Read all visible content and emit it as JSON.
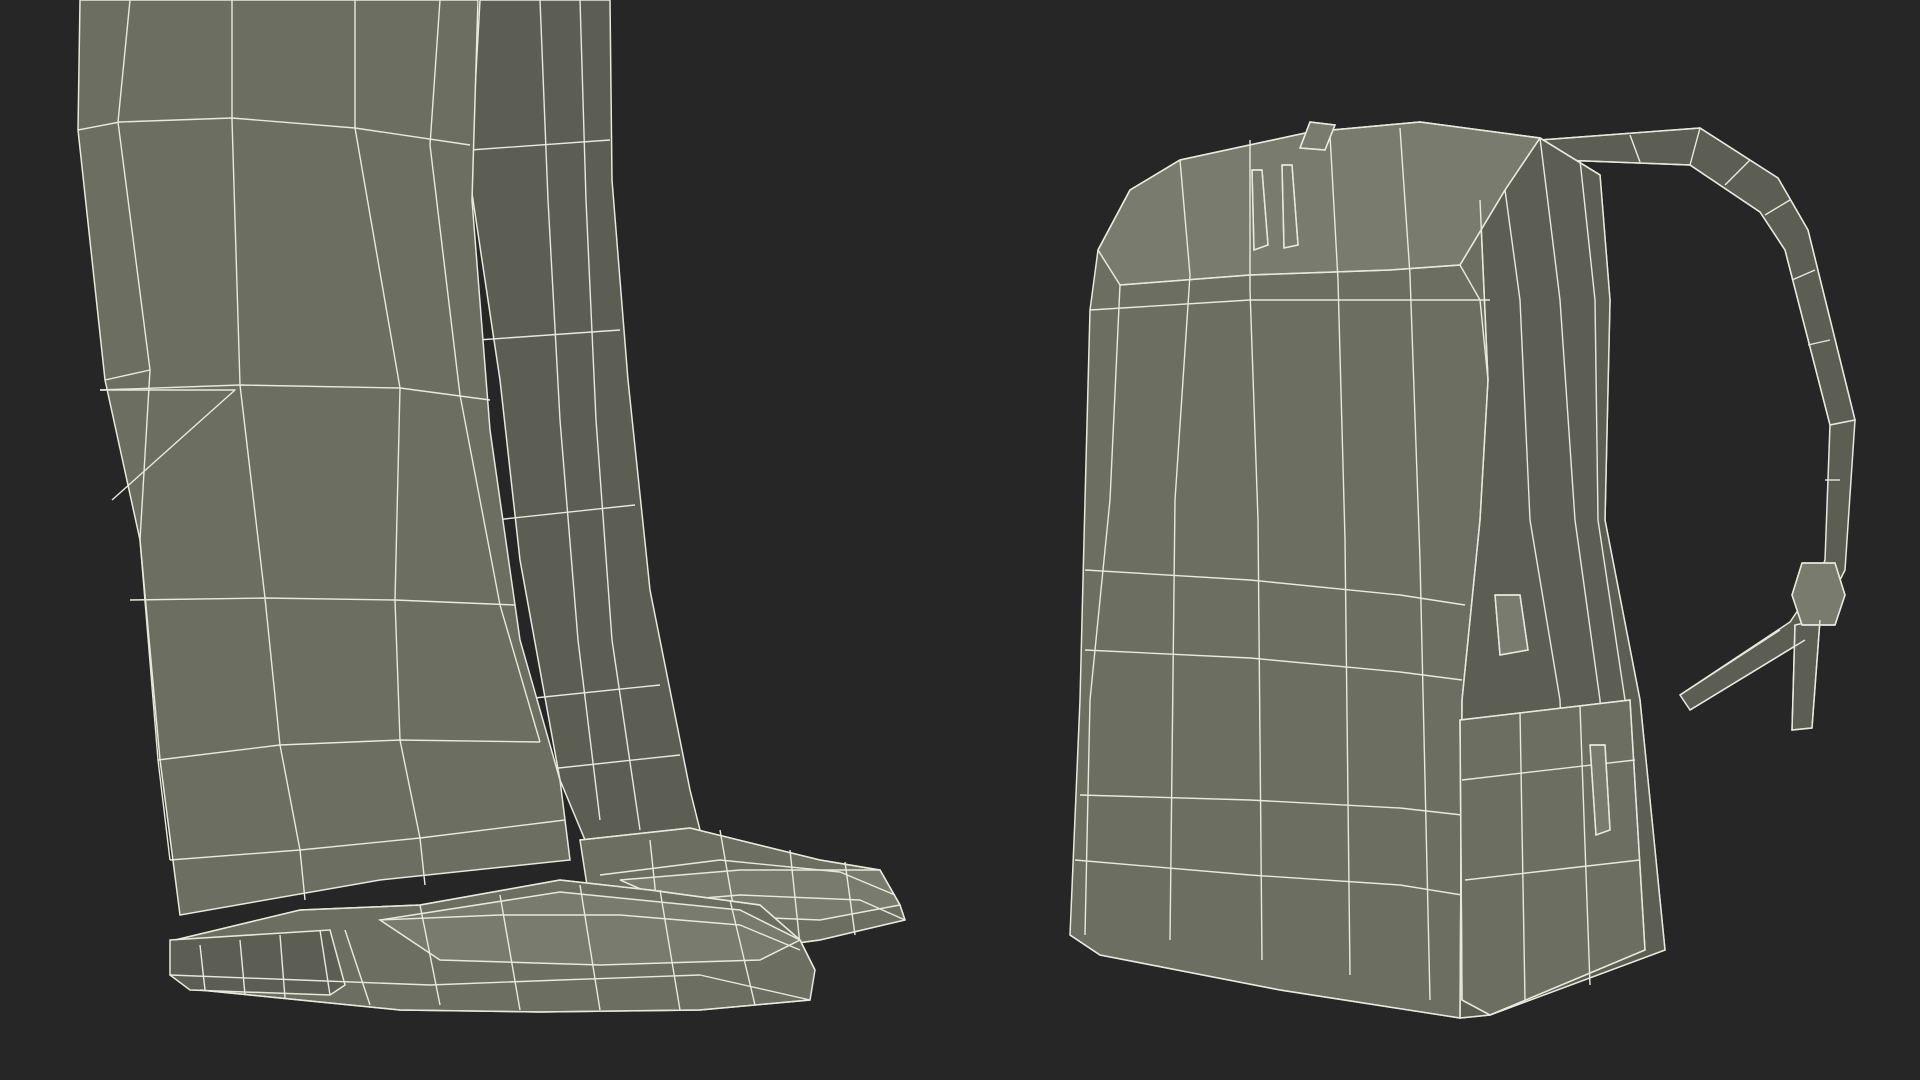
{
  "scene": {
    "background_color": "#262626",
    "surface_color": "#6d6e62",
    "surface_dark_color": "#5d5e53",
    "surface_light_color": "#7a7b6f",
    "wire_color": "#e8e8dc"
  }
}
